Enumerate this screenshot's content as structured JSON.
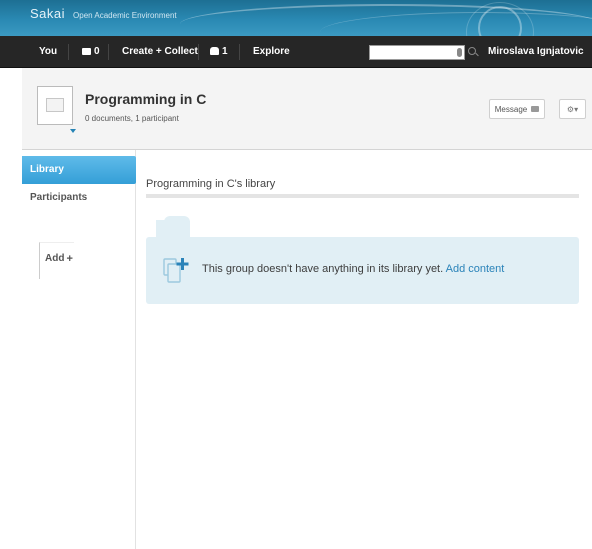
{
  "banner": {
    "logo": "Sakai",
    "tagline": "Open Academic Environment"
  },
  "topnav": {
    "you": "You",
    "messages_count": "0",
    "create_collect": "Create + Collect",
    "notifications_count": "1",
    "explore": "Explore",
    "search_placeholder": "",
    "user_name": "Miroslava Ignjatovic"
  },
  "group": {
    "title": "Programming in C",
    "subtitle": "0 documents, 1 participant",
    "message_label": "Message",
    "settings_label": "▾"
  },
  "leftnav": {
    "items": [
      {
        "label": "Library",
        "active": true
      },
      {
        "label": "Participants",
        "active": false
      }
    ],
    "add_label": "Add",
    "add_plus": "+"
  },
  "main": {
    "library_title": "Programming in C's library",
    "empty_message": "This group doesn't have anything in its library yet.",
    "add_content_link": "Add content"
  },
  "colors": {
    "banner": "#2a89b3",
    "topnav": "#262626",
    "accent": "#349fd7",
    "link": "#2a83b9",
    "empty_bg": "#e1eff5"
  }
}
